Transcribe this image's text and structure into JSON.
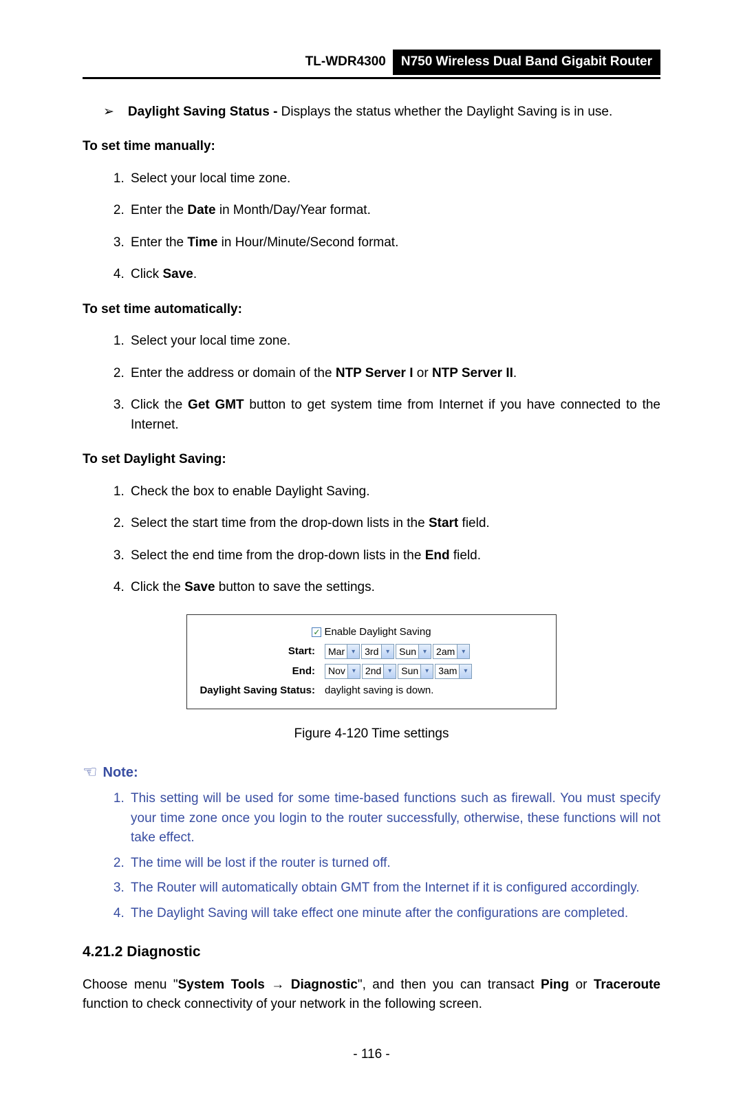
{
  "header": {
    "model": "TL-WDR4300",
    "product": "N750 Wireless Dual Band Gigabit Router"
  },
  "bullet": {
    "label": "Daylight Saving Status -",
    "text": " Displays the status whether the Daylight Saving is in use."
  },
  "manual": {
    "title": "To set time manually:",
    "s1": "Select your local time zone.",
    "s2a": "Enter the ",
    "s2b": "Date",
    "s2c": " in Month/Day/Year format.",
    "s3a": "Enter the ",
    "s3b": "Time",
    "s3c": " in Hour/Minute/Second format.",
    "s4a": "Click ",
    "s4b": "Save",
    "s4c": "."
  },
  "auto": {
    "title": "To set time automatically:",
    "s1": "Select your local time zone.",
    "s2a": "Enter the address or domain of the ",
    "s2b": "NTP Server I",
    "s2c": " or ",
    "s2d": "NTP Server II",
    "s2e": ".",
    "s3a": "Click the ",
    "s3b": "Get GMT",
    "s3c": " button to get system time from Internet if you have connected to the Internet."
  },
  "dst": {
    "title": "To set Daylight Saving:",
    "s1": "Check the box to enable Daylight Saving.",
    "s2a": "Select the start time from the drop-down lists in the ",
    "s2b": "Start",
    "s2c": " field.",
    "s3a": "Select the end time from the drop-down lists in the ",
    "s3b": "End",
    "s3c": " field.",
    "s4a": "Click the ",
    "s4b": "Save",
    "s4c": " button to save the settings."
  },
  "figure": {
    "enable": "Enable Daylight Saving",
    "start_label": "Start:",
    "end_label": "End:",
    "status_label": "Daylight Saving Status:",
    "status_value": "daylight saving is down.",
    "start": {
      "month": "Mar",
      "week": "3rd",
      "day": "Sun",
      "hour": "2am"
    },
    "end": {
      "month": "Nov",
      "week": "2nd",
      "day": "Sun",
      "hour": "3am"
    },
    "caption": "Figure 4-120 Time settings"
  },
  "note": {
    "title": "Note:",
    "n1": "This setting will be used for some time-based functions such as firewall. You must specify your time zone once you login to the router successfully, otherwise, these functions will not take effect.",
    "n2": "The time will be lost if the router is turned off.",
    "n3": "The Router will automatically obtain GMT from the Internet if it is configured accordingly.",
    "n4": "The Daylight Saving will take effect one minute after the configurations are completed."
  },
  "diag": {
    "head": "4.21.2  Diagnostic",
    "p1a": "Choose menu \"",
    "p1b": "System Tools",
    "p1c": " → ",
    "p1d": "Diagnostic",
    "p1e": "\", and then you can transact ",
    "p1f": "Ping",
    "p1g": " or ",
    "p1h": "Traceroute",
    "p1i": " function to check connectivity of your network in the following screen."
  },
  "page_num": "- 116 -"
}
